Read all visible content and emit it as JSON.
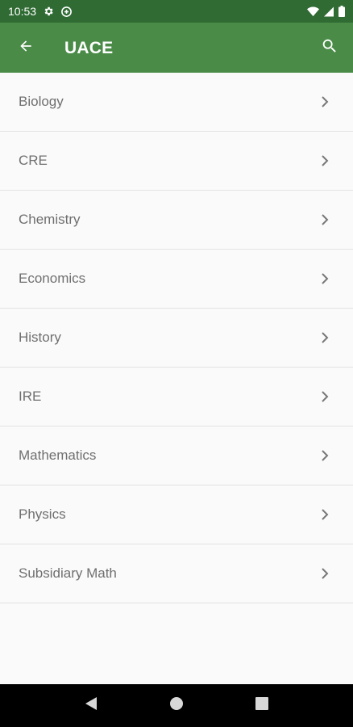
{
  "status_bar": {
    "time": "10:53",
    "icons": [
      "settings-icon",
      "data-saver-icon",
      "wifi-icon",
      "signal-icon",
      "battery-icon"
    ]
  },
  "app_bar": {
    "title": "UACE",
    "back_icon": "arrow-back-icon",
    "search_icon": "search-icon",
    "color": "#4a8b48"
  },
  "subjects": [
    {
      "label": "Biology"
    },
    {
      "label": "CRE"
    },
    {
      "label": "Chemistry"
    },
    {
      "label": "Economics"
    },
    {
      "label": "History"
    },
    {
      "label": "IRE"
    },
    {
      "label": "Mathematics"
    },
    {
      "label": "Physics"
    },
    {
      "label": "Subsidiary Math"
    }
  ],
  "nav_bar": {
    "icons": [
      "nav-back-icon",
      "nav-home-icon",
      "nav-recents-icon"
    ]
  }
}
